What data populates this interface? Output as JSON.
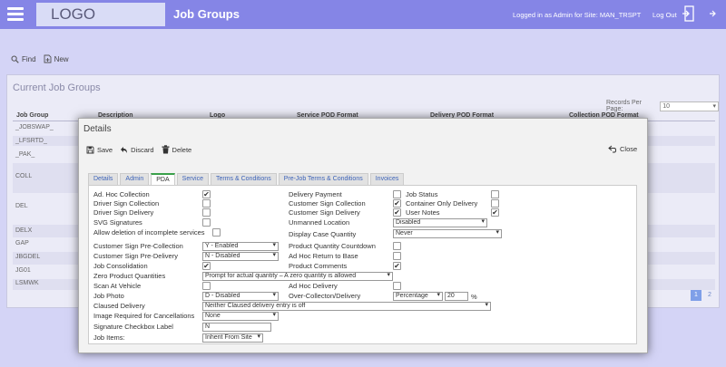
{
  "header": {
    "logo": "LOGO",
    "title": "Job Groups",
    "login_info": "Logged in as Admin for Site: MAN_TRSPT",
    "logout": "Log Out"
  },
  "toolbar": {
    "find": "Find",
    "new": "New"
  },
  "main": {
    "title": "Current Job Groups",
    "records_per_page_label": "Records Per Page:",
    "records_per_page": "10",
    "columns": [
      "Job Group",
      "Description",
      "Logo",
      "Service POD Format",
      "Delivery POD Format",
      "Collection POD Format"
    ],
    "rows": [
      "_JOBSWAP_",
      "_LFSRTD_",
      "_PAK_",
      "COLL",
      "DEL",
      "DELX",
      "GAP",
      "JBGDEL",
      "JG01",
      "LSMWK"
    ],
    "pages": [
      "1",
      "2"
    ]
  },
  "dialog": {
    "title": "Details",
    "save": "Save",
    "discard": "Discard",
    "delete": "Delete",
    "close": "Close",
    "tabs": [
      "Details",
      "Admin",
      "PDA",
      "Service",
      "Terms & Conditions",
      "Pre-Job Terms & Conditions",
      "Invoices"
    ],
    "left": {
      "ad_hoc_collection": "Ad. Hoc Collection",
      "driver_sign_collection": "Driver Sign Collection",
      "driver_sign_delivery": "Driver Sign Delivery",
      "svg_signatures": "SVG Signatures",
      "allow_deletion": "Allow deletion of incomplete services",
      "customer_sign_pre_collection": "Customer Sign Pre-Collection",
      "customer_sign_pre_collection_value": "Y - Enabled",
      "customer_sign_pre_delivery": "Customer Sign Pre-Delivery",
      "customer_sign_pre_delivery_value": "N - Disabled",
      "job_consolidation": "Job Consolidation",
      "zero_product_quantities": "Zero Product Quantities",
      "zero_product_quantities_value": "Prompt for actual quantity – A zero quantity is allowed",
      "scan_at_vehicle": "Scan At Vehicle",
      "job_photo": "Job Photo",
      "job_photo_value": "D - Disabled",
      "claused_delivery": "Claused Delivery",
      "claused_delivery_value": "Neither Claused delivery entry is off",
      "image_required": "Image Required for Cancellations",
      "image_required_value": "None",
      "signature_checkbox_label": "Signature Checkbox Label",
      "signature_checkbox_value": "N",
      "job_items": "Job Items:",
      "job_items_value": "Inherit From Site"
    },
    "mid": {
      "delivery_payment": "Delivery Payment",
      "customer_sign_collection": "Customer Sign Collection",
      "customer_sign_delivery": "Customer Sign Delivery",
      "unmanned_location": "Unmanned Location",
      "unmanned_location_value": "Disabled",
      "display_case_quantity": "Display Case Quantity",
      "display_case_quantity_value": "Never",
      "product_quantity_countdown": "Product Quantity Countdown",
      "ad_hoc_return_to_base": "Ad Hoc Return to Base",
      "product_comments": "Product Comments",
      "ad_hoc_delivery": "Ad Hoc Delivery",
      "over_collection_delivery": "Over-Collecton/Delivery",
      "over_collection_type": "Percentage",
      "over_collection_value": "20",
      "percent": "%"
    },
    "right": {
      "job_status": "Job Status",
      "container_only_delivery": "Container Only Delivery",
      "user_notes": "User Notes"
    }
  }
}
